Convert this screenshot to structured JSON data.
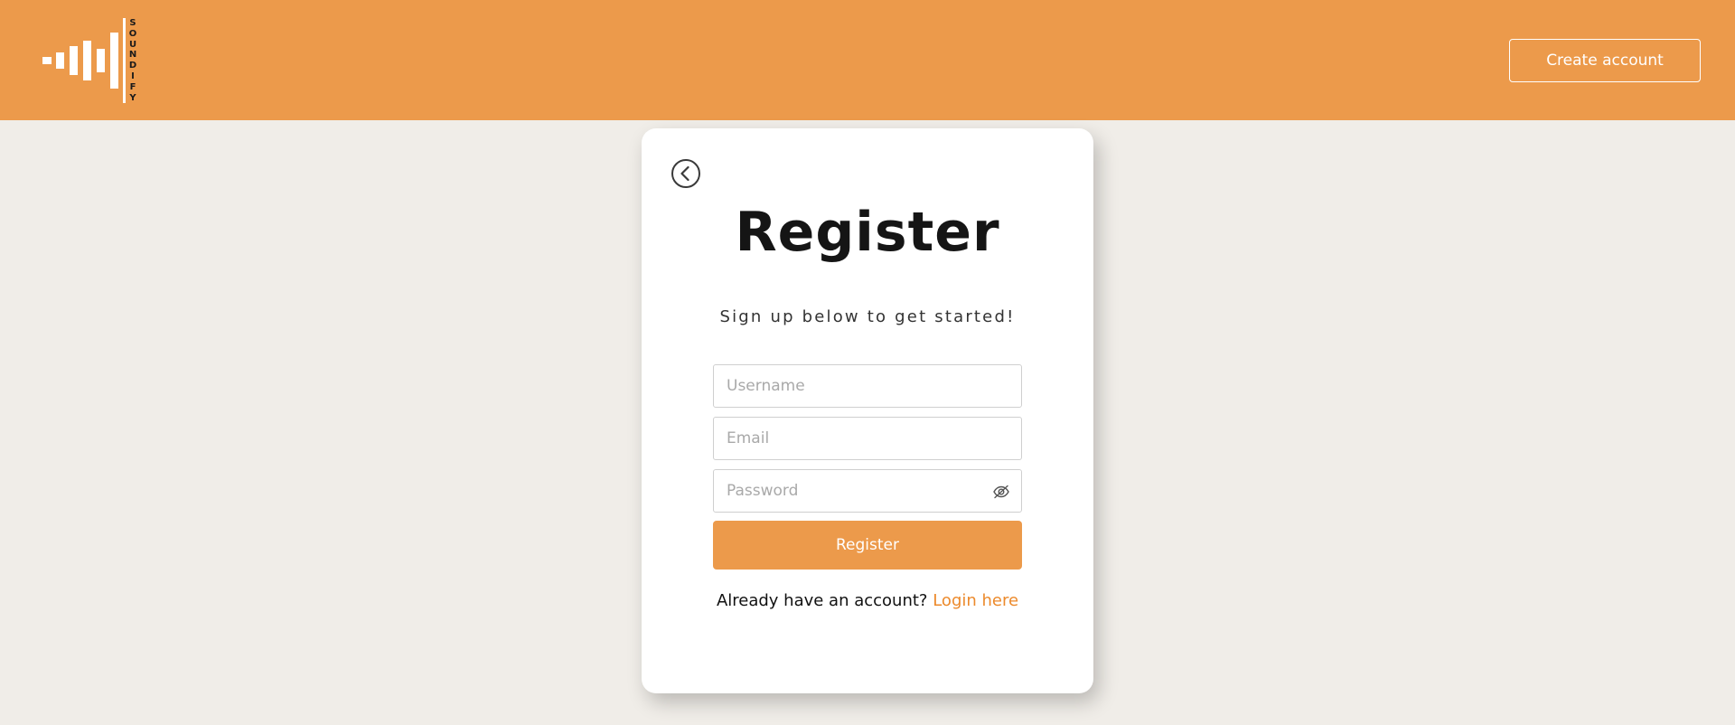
{
  "brand": {
    "name_letters": [
      "S",
      "O",
      "U",
      "N",
      "D",
      "I",
      "F",
      "Y"
    ],
    "logo_icon": "soundwave-bars-icon"
  },
  "header": {
    "create_account_label": "Create account"
  },
  "card": {
    "back_icon": "chevron-left-circle-icon",
    "title": "Register",
    "subtitle": "Sign up below to get started!",
    "username_placeholder": "Username",
    "username_value": "",
    "email_placeholder": "Email",
    "email_value": "",
    "password_placeholder": "Password",
    "password_value": "",
    "password_toggle_icon": "eye-slash-icon",
    "register_label": "Register",
    "login_prompt": "Already have an account?",
    "login_link": "Login here"
  },
  "colors": {
    "brand_orange": "#ec9a4b",
    "link_orange": "#ec8a2c",
    "page_background": "#f0ede8",
    "card_background": "#ffffff"
  }
}
